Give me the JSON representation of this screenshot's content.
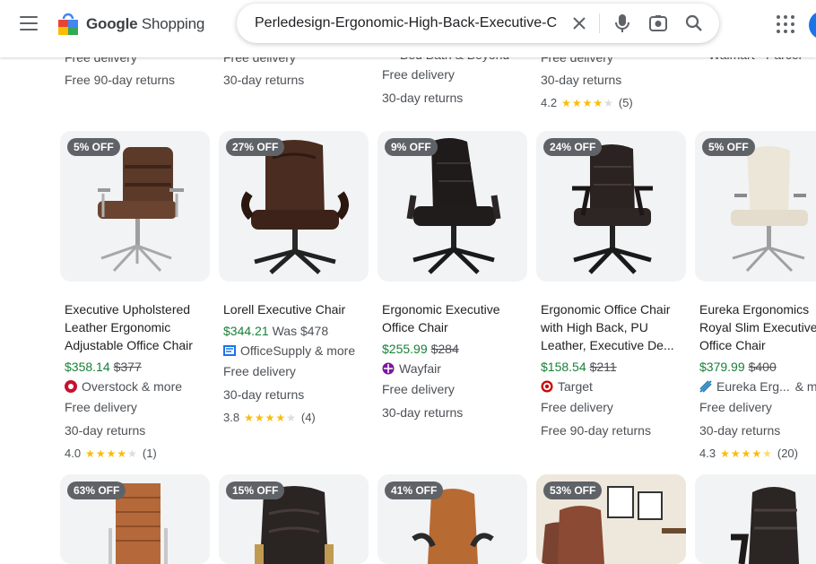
{
  "header": {
    "logo_text_bold": "Google",
    "logo_text": "Shopping",
    "search_value": "Perledesign-Ergonomic-High-Back-Executive-C",
    "icons": [
      "menu-icon",
      "google-shopping-logo-icon",
      "clear-icon",
      "microphone-icon",
      "camera-lens-icon",
      "search-icon",
      "apps-icon",
      "avatar"
    ]
  },
  "top_partial": {
    "col1": [
      "Free delivery",
      "Free 90-day returns"
    ],
    "col2": [
      "Free delivery",
      "30-day returns"
    ],
    "col3": [
      "Bed Bath & Beyond",
      "Free delivery",
      "30-day returns"
    ],
    "col4": [
      "Free delivery",
      "30-day returns"
    ],
    "col4_rating": "4.2",
    "col4_reviews": "(5)",
    "col5": [
      "Walmart - Parcel"
    ]
  },
  "products": [
    {
      "badge": "5% OFF",
      "title": "Executive Upholstered Leather Ergonomic Adjustable Office Chair",
      "price": "$358.14",
      "old": "$377",
      "store": "Overstock & more",
      "delivery": "Free delivery",
      "returns": "30-day returns",
      "rating": "4.0",
      "reviews": "(1)",
      "stars": 4
    },
    {
      "badge": "27% OFF",
      "title": "Lorell Executive Chair",
      "price": "$344.21",
      "was": "Was $478",
      "store": "OfficeSupply & more",
      "delivery": "Free delivery",
      "returns": "30-day returns",
      "rating": "3.8",
      "reviews": "(4)",
      "stars": 4
    },
    {
      "badge": "9% OFF",
      "title": "Ergonomic Executive Office Chair",
      "price": "$255.99",
      "old": "$284",
      "store": "Wayfair",
      "delivery": "Free delivery",
      "returns": "30-day returns"
    },
    {
      "badge": "24% OFF",
      "title": "Ergonomic Office Chair with High Back, PU Leather, Executive De...",
      "price": "$158.54",
      "old": "$211",
      "store": "Target",
      "delivery": "Free delivery",
      "returns": "Free 90-day returns"
    },
    {
      "badge": "5% OFF",
      "title": "Eureka Ergonomics Royal Slim Executive Office Chair",
      "price": "$379.99",
      "old": "$400",
      "store": "Eureka Erg...",
      "store_more": "& m",
      "delivery": "Free delivery",
      "returns": "30-day returns",
      "rating": "4.3",
      "reviews": "(20)",
      "stars": 4.5
    }
  ],
  "bottom_badges": [
    "63% OFF",
    "15% OFF",
    "41% OFF",
    "53% OFF"
  ],
  "colors": {
    "price": "#188038",
    "star": "#fbbc04",
    "badge_bg": "#5f6368",
    "card_bg": "#f1f3f4"
  }
}
